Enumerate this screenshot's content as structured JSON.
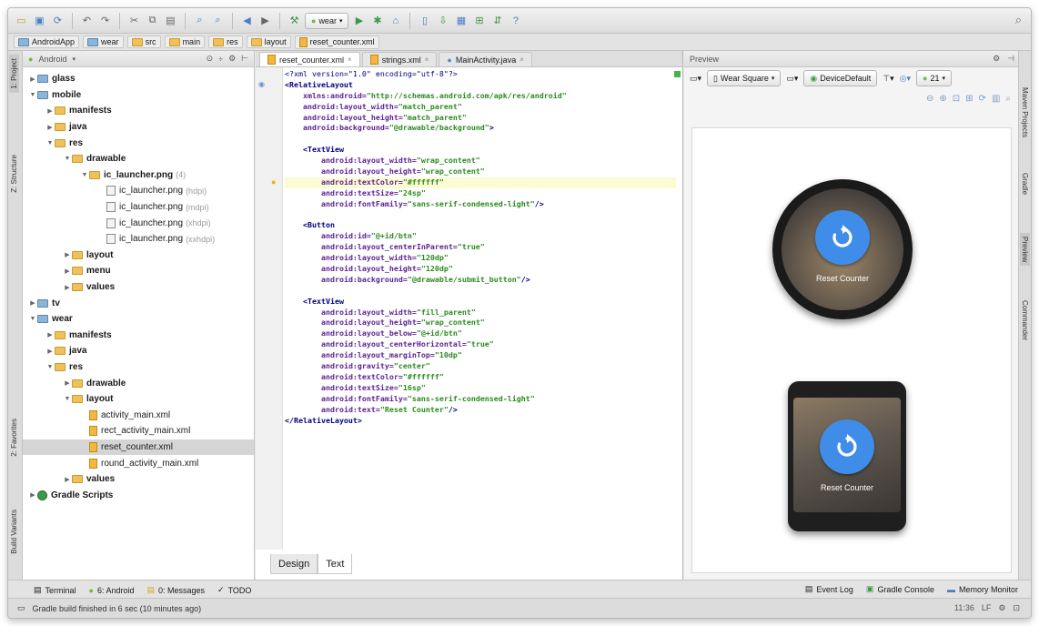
{
  "toolbar": {
    "run_config": "wear"
  },
  "breadcrumb": [
    "AndroidApp",
    "wear",
    "src",
    "main",
    "res",
    "layout",
    "reset_counter.xml"
  ],
  "side_tabs": {
    "project": "1: Project",
    "structure": "Z: Structure",
    "favorites": "2: Favorites",
    "build_variants": "Build Variants"
  },
  "right_tabs": {
    "maven": "Maven Projects",
    "gradle": "Gradle",
    "preview": "Preview",
    "commander": "Commander"
  },
  "project_panel": {
    "view_mode": "Android",
    "tree": [
      {
        "label": "glass",
        "indent": 0,
        "expanded": false,
        "kind": "module"
      },
      {
        "label": "mobile",
        "indent": 0,
        "expanded": true,
        "kind": "module"
      },
      {
        "label": "manifests",
        "indent": 1,
        "expanded": false,
        "kind": "folder"
      },
      {
        "label": "java",
        "indent": 1,
        "expanded": false,
        "kind": "folder"
      },
      {
        "label": "res",
        "indent": 1,
        "expanded": true,
        "kind": "folder"
      },
      {
        "label": "drawable",
        "indent": 2,
        "expanded": true,
        "kind": "folder"
      },
      {
        "label": "ic_launcher.png",
        "suffix": "(4)",
        "indent": 3,
        "expanded": true,
        "kind": "folder"
      },
      {
        "label": "ic_launcher.png",
        "suffix": "(hdpi)",
        "indent": 4,
        "kind": "png"
      },
      {
        "label": "ic_launcher.png",
        "suffix": "(mdpi)",
        "indent": 4,
        "kind": "png"
      },
      {
        "label": "ic_launcher.png",
        "suffix": "(xhdpi)",
        "indent": 4,
        "kind": "png"
      },
      {
        "label": "ic_launcher.png",
        "suffix": "(xxhdpi)",
        "indent": 4,
        "kind": "png"
      },
      {
        "label": "layout",
        "indent": 2,
        "expanded": false,
        "kind": "folder"
      },
      {
        "label": "menu",
        "indent": 2,
        "expanded": false,
        "kind": "folder"
      },
      {
        "label": "values",
        "indent": 2,
        "expanded": false,
        "kind": "folder"
      },
      {
        "label": "tv",
        "indent": 0,
        "expanded": false,
        "kind": "module"
      },
      {
        "label": "wear",
        "indent": 0,
        "expanded": true,
        "kind": "module"
      },
      {
        "label": "manifests",
        "indent": 1,
        "expanded": false,
        "kind": "folder"
      },
      {
        "label": "java",
        "indent": 1,
        "expanded": false,
        "kind": "folder"
      },
      {
        "label": "res",
        "indent": 1,
        "expanded": true,
        "kind": "folder"
      },
      {
        "label": "drawable",
        "indent": 2,
        "expanded": false,
        "kind": "folder"
      },
      {
        "label": "layout",
        "indent": 2,
        "expanded": true,
        "kind": "folder"
      },
      {
        "label": "activity_main.xml",
        "indent": 3,
        "kind": "xml"
      },
      {
        "label": "rect_activity_main.xml",
        "indent": 3,
        "kind": "xml"
      },
      {
        "label": "reset_counter.xml",
        "indent": 3,
        "kind": "xml",
        "selected": true
      },
      {
        "label": "round_activity_main.xml",
        "indent": 3,
        "kind": "xml"
      },
      {
        "label": "values",
        "indent": 2,
        "expanded": false,
        "kind": "folder"
      },
      {
        "label": "Gradle Scripts",
        "indent": 0,
        "expanded": false,
        "kind": "gradle"
      }
    ]
  },
  "editor": {
    "tabs": [
      {
        "label": "reset_counter.xml",
        "active": true
      },
      {
        "label": "strings.xml",
        "active": false
      },
      {
        "label": "MainActivity.java",
        "active": false
      }
    ],
    "code_lines": [
      [
        [
          "pi",
          "<?xml version=\"1.0\" encoding=\"utf-8\"?>"
        ]
      ],
      [
        [
          "tag",
          "<RelativeLayout"
        ]
      ],
      [
        [
          "txt",
          "    "
        ],
        [
          "attr",
          "xmlns:android="
        ],
        [
          "val",
          "\"http://schemas.android.com/apk/res/android\""
        ]
      ],
      [
        [
          "txt",
          "    "
        ],
        [
          "attr",
          "android:layout_width="
        ],
        [
          "val",
          "\"match_parent\""
        ]
      ],
      [
        [
          "txt",
          "    "
        ],
        [
          "attr",
          "android:layout_height="
        ],
        [
          "val",
          "\"match_parent\""
        ]
      ],
      [
        [
          "txt",
          "    "
        ],
        [
          "attr",
          "android:background="
        ],
        [
          "val",
          "\"@drawable/background\""
        ],
        [
          "tag",
          ">"
        ]
      ],
      [],
      [
        [
          "txt",
          "    "
        ],
        [
          "tag",
          "<TextView"
        ]
      ],
      [
        [
          "txt",
          "        "
        ],
        [
          "attr",
          "android:layout_width="
        ],
        [
          "val",
          "\"wrap_content\""
        ]
      ],
      [
        [
          "txt",
          "        "
        ],
        [
          "attr",
          "android:layout_height="
        ],
        [
          "val",
          "\"wrap_content\""
        ]
      ],
      [
        [
          "txt",
          "        "
        ],
        [
          "attr",
          "android:textColor="
        ],
        [
          "val",
          "\"#ffffff\""
        ]
      ],
      [
        [
          "txt",
          "        "
        ],
        [
          "attr",
          "android:textSize="
        ],
        [
          "val",
          "\"24sp\""
        ]
      ],
      [
        [
          "txt",
          "        "
        ],
        [
          "attr",
          "android:fontFamily="
        ],
        [
          "val",
          "\"sans-serif-condensed-light\""
        ],
        [
          "tag",
          "/>"
        ]
      ],
      [],
      [
        [
          "txt",
          "    "
        ],
        [
          "tag",
          "<Button"
        ]
      ],
      [
        [
          "txt",
          "        "
        ],
        [
          "attr",
          "android:id="
        ],
        [
          "val",
          "\"@+id/btn\""
        ]
      ],
      [
        [
          "txt",
          "        "
        ],
        [
          "attr",
          "android:layout_centerInParent="
        ],
        [
          "val",
          "\"true\""
        ]
      ],
      [
        [
          "txt",
          "        "
        ],
        [
          "attr",
          "android:layout_width="
        ],
        [
          "val",
          "\"120dp\""
        ]
      ],
      [
        [
          "txt",
          "        "
        ],
        [
          "attr",
          "android:layout_height="
        ],
        [
          "val",
          "\"120dp\""
        ]
      ],
      [
        [
          "txt",
          "        "
        ],
        [
          "attr",
          "android:background="
        ],
        [
          "val",
          "\"@drawable/submit_button\""
        ],
        [
          "tag",
          "/>"
        ]
      ],
      [],
      [
        [
          "txt",
          "    "
        ],
        [
          "tag",
          "<TextView"
        ]
      ],
      [
        [
          "txt",
          "        "
        ],
        [
          "attr",
          "android:layout_width="
        ],
        [
          "val",
          "\"fill_parent\""
        ]
      ],
      [
        [
          "txt",
          "        "
        ],
        [
          "attr",
          "android:layout_height="
        ],
        [
          "val",
          "\"wrap_content\""
        ]
      ],
      [
        [
          "txt",
          "        "
        ],
        [
          "attr",
          "android:layout_below="
        ],
        [
          "val",
          "\"@+id/btn\""
        ]
      ],
      [
        [
          "txt",
          "        "
        ],
        [
          "attr",
          "android:layout_centerHorizontal="
        ],
        [
          "val",
          "\"true\""
        ]
      ],
      [
        [
          "txt",
          "        "
        ],
        [
          "attr",
          "android:layout_marginTop="
        ],
        [
          "val",
          "\"10dp\""
        ]
      ],
      [
        [
          "txt",
          "        "
        ],
        [
          "attr",
          "android:gravity="
        ],
        [
          "val",
          "\"center\""
        ]
      ],
      [
        [
          "txt",
          "        "
        ],
        [
          "attr",
          "android:textColor="
        ],
        [
          "val",
          "\"#ffffff\""
        ]
      ],
      [
        [
          "txt",
          "        "
        ],
        [
          "attr",
          "android:textSize="
        ],
        [
          "val",
          "\"16sp\""
        ]
      ],
      [
        [
          "txt",
          "        "
        ],
        [
          "attr",
          "android:fontFamily="
        ],
        [
          "val",
          "\"sans-serif-condensed-light\""
        ]
      ],
      [
        [
          "txt",
          "        "
        ],
        [
          "attr",
          "android:text="
        ],
        [
          "val",
          "\"Reset Counter\""
        ],
        [
          "tag",
          "/>"
        ]
      ],
      [
        [
          "tag",
          "</RelativeLayout>"
        ]
      ]
    ],
    "highlighted_line": 10,
    "bottom_tabs": [
      "Design",
      "Text"
    ],
    "active_bottom_tab": "Text"
  },
  "preview": {
    "title": "Preview",
    "device": "Wear Square",
    "theme": "DeviceDefault",
    "api_level": "21",
    "round_label": "Reset Counter",
    "square_label": "Reset Counter",
    "accent_color": "#3f8de8"
  },
  "tool_windows": {
    "left": [
      "Terminal",
      "6: Android",
      "0: Messages",
      "TODO"
    ],
    "right": [
      "Event Log",
      "Gradle Console",
      "Memory Monitor"
    ]
  },
  "status": {
    "message": "Gradle build finished in 6 sec (10 minutes ago)",
    "position": "11:36",
    "line_sep": "LF"
  }
}
